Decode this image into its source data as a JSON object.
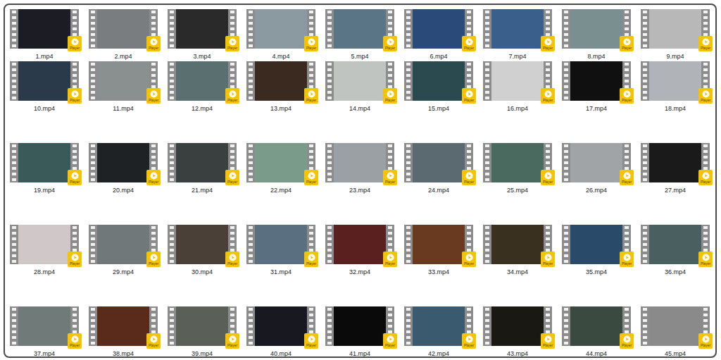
{
  "badge_label": "Player",
  "files": [
    {
      "name": "1.mp4",
      "color": "#1c1c24"
    },
    {
      "name": "2.mp4",
      "color": "#7a7d80"
    },
    {
      "name": "3.mp4",
      "color": "#2a2a2a"
    },
    {
      "name": "4.mp4",
      "color": "#8a9aa0"
    },
    {
      "name": "5.mp4",
      "color": "#5a7585"
    },
    {
      "name": "6.mp4",
      "color": "#2a4a7a"
    },
    {
      "name": "7.mp4",
      "color": "#3a5f8a"
    },
    {
      "name": "8.mp4",
      "color": "#7a8f90"
    },
    {
      "name": "9.mp4",
      "color": "#b8b8b8"
    },
    {
      "name": "10.mp4",
      "color": "#2a3a4a"
    },
    {
      "name": "11.mp4",
      "color": "#8a8f90"
    },
    {
      "name": "12.mp4",
      "color": "#5a7070"
    },
    {
      "name": "13.mp4",
      "color": "#3a2a20"
    },
    {
      "name": "14.mp4",
      "color": "#c0c4c0"
    },
    {
      "name": "15.mp4",
      "color": "#2a4a50"
    },
    {
      "name": "16.mp4",
      "color": "#d0d0d0"
    },
    {
      "name": "17.mp4",
      "color": "#101010"
    },
    {
      "name": "18.mp4",
      "color": "#b0b4b8"
    },
    {
      "name": "19.mp4",
      "color": "#3a5a5a"
    },
    {
      "name": "20.mp4",
      "color": "#1e2224"
    },
    {
      "name": "21.mp4",
      "color": "#3a3f40"
    },
    {
      "name": "22.mp4",
      "color": "#7a9a8a"
    },
    {
      "name": "23.mp4",
      "color": "#9aa0a4"
    },
    {
      "name": "24.mp4",
      "color": "#5a6a70"
    },
    {
      "name": "25.mp4",
      "color": "#4a6a60"
    },
    {
      "name": "26.mp4",
      "color": "#a0a4a6"
    },
    {
      "name": "27.mp4",
      "color": "#1a1a1a"
    },
    {
      "name": "28.mp4",
      "color": "#d0c8c8"
    },
    {
      "name": "29.mp4",
      "color": "#70787a"
    },
    {
      "name": "30.mp4",
      "color": "#4a4038"
    },
    {
      "name": "31.mp4",
      "color": "#5a7080"
    },
    {
      "name": "32.mp4",
      "color": "#5a2020"
    },
    {
      "name": "33.mp4",
      "color": "#6a3a20"
    },
    {
      "name": "34.mp4",
      "color": "#3a3020"
    },
    {
      "name": "35.mp4",
      "color": "#2a4a6a"
    },
    {
      "name": "36.mp4",
      "color": "#4a6060"
    },
    {
      "name": "37.mp4",
      "color": "#707a78"
    },
    {
      "name": "38.mp4",
      "color": "#5a2a1a"
    },
    {
      "name": "39.mp4",
      "color": "#5a6058"
    },
    {
      "name": "40.mp4",
      "color": "#181820"
    },
    {
      "name": "41.mp4",
      "color": "#0a0a0a"
    },
    {
      "name": "42.mp4",
      "color": "#3a5a70"
    },
    {
      "name": "43.mp4",
      "color": "#1a1812"
    },
    {
      "name": "44.mp4",
      "color": "#3a4a40"
    },
    {
      "name": "45.mp4",
      "color": "#8a8a8a"
    }
  ]
}
